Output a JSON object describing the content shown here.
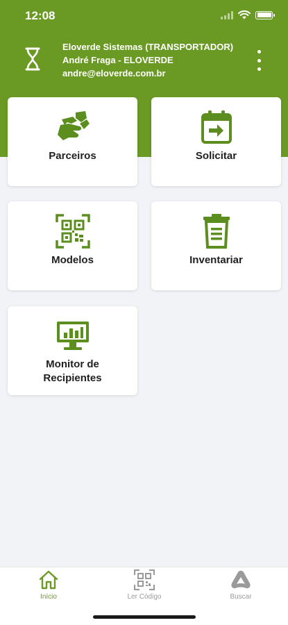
{
  "status_bar": {
    "time": "12:08"
  },
  "account": {
    "company": "Eloverde Sistemas (TRANSPORTADOR)",
    "user": "André Fraga - ELOVERDE",
    "email": "andre@eloverde.com.br"
  },
  "menu": {
    "icon": "more-vertical-icon"
  },
  "cards": [
    {
      "id": "parceiros",
      "label": "Parceiros",
      "icon": "handshake-icon"
    },
    {
      "id": "solicitar",
      "label": "Solicitar",
      "icon": "calendar-arrow-icon"
    },
    {
      "id": "modelos",
      "label": "Modelos",
      "icon": "qr-code-icon"
    },
    {
      "id": "inventariar",
      "label": "Inventariar",
      "icon": "trash-bin-icon"
    },
    {
      "id": "monitor",
      "label_line1": "Monitor de",
      "label_line2": "Recipientes",
      "icon": "monitor-chart-icon"
    }
  ],
  "tabs": [
    {
      "id": "inicio",
      "label": "Início",
      "icon": "home-icon",
      "active": true
    },
    {
      "id": "ler_codigo",
      "label": "Ler Código",
      "icon": "qr-scan-icon",
      "active": false
    },
    {
      "id": "buscar",
      "label": "Buscar",
      "icon": "buscar-logo-icon",
      "active": false
    }
  ],
  "colors": {
    "brand_green": "#6a9a24",
    "icon_green": "#5b8e1e",
    "tab_active": "#6a9a24",
    "tab_inactive": "#9a9a9a",
    "background": "#f2f3f7"
  }
}
